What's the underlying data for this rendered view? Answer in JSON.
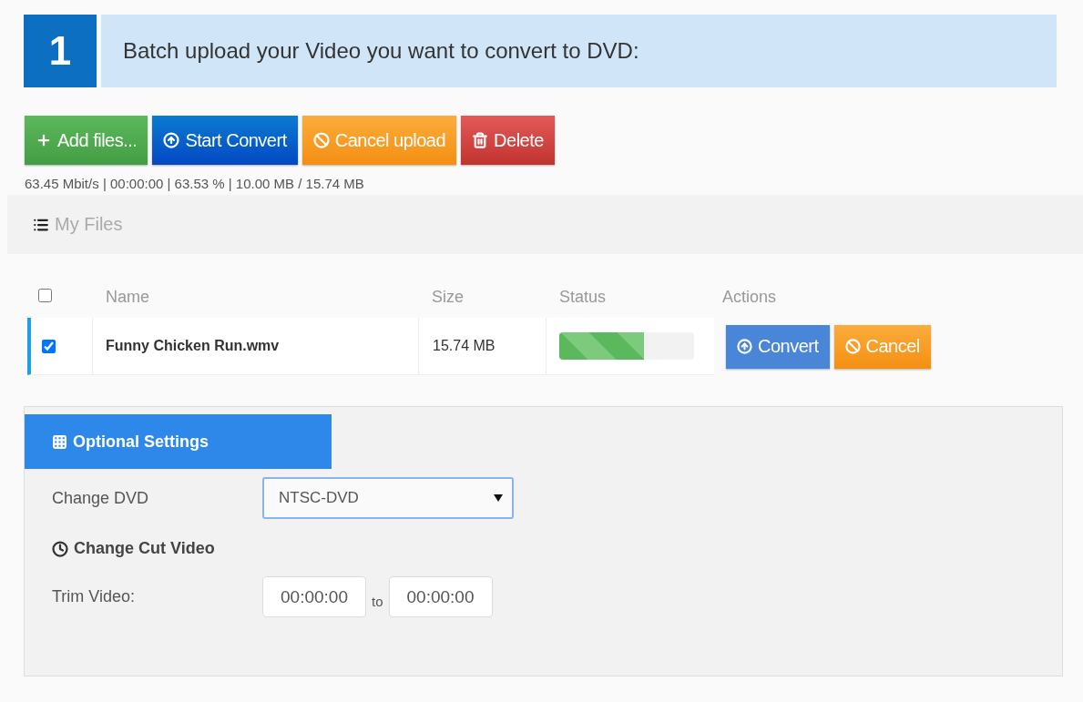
{
  "step": {
    "number": "1",
    "title": "Batch upload your Video you want to convert to DVD:"
  },
  "toolbar": [
    {
      "kind": "add",
      "label": "Add files..."
    },
    {
      "kind": "start",
      "label": "Start Convert"
    },
    {
      "kind": "cancel",
      "label": "Cancel upload"
    },
    {
      "kind": "delete",
      "label": "Delete"
    }
  ],
  "upload_stats": "63.45 Mbit/s | 00:00:00 | 63.53 % | 10.00 MB / 15.74 MB",
  "files_section": {
    "title": "My Files"
  },
  "table": {
    "select_all": {
      "checked": false
    },
    "columns": [
      "Name",
      "Size",
      "Status",
      "Actions"
    ],
    "rows": [
      {
        "checked": true,
        "name": "Funny Chicken Run.wmv",
        "size": "15.74 MB",
        "level": 0.63,
        "actions": [
          {
            "kind": "start",
            "label": "Convert"
          },
          {
            "kind": "cancel",
            "label": "Cancel"
          }
        ]
      }
    ]
  },
  "settings": {
    "tab": "Optional Settings",
    "dvd_label": "Change DVD",
    "dvd_value": "NTSC-DVD",
    "cut_title": "Change Cut Video",
    "trim_label": "Trim Video:",
    "trim_from": "00:00:00",
    "trim_sep": "to",
    "trim_to": "00:00:00"
  }
}
